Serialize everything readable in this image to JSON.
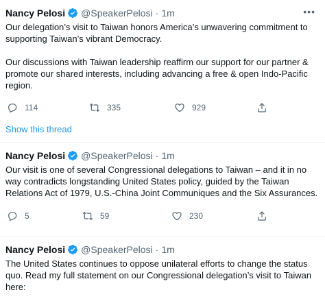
{
  "colors": {
    "accent": "#1d9bf0",
    "text": "#0f1419",
    "secondary": "#536471"
  },
  "tweets": [
    {
      "name": "Nancy Pelosi",
      "handle": "@SpeakerPelosi",
      "separator": "·",
      "time": "1m",
      "paragraphs": [
        "Our delegation’s visit to Taiwan honors America’s unwavering commitment to supporting Taiwan’s vibrant Democracy.",
        "Our discussions with Taiwan leadership reaffirm our support for our partner & promote our shared interests, including advancing a free & open Indo-Pacific region."
      ],
      "replies": "114",
      "retweets": "335",
      "likes": "929"
    },
    {
      "name": "Nancy Pelosi",
      "handle": "@SpeakerPelosi",
      "separator": "·",
      "time": "1m",
      "paragraphs": [
        "Our visit is one of several Congressional delegations to Taiwan – and it in no way contradicts longstanding United States policy, guided by the Taiwan Relations Act of 1979, U.S.-China Joint Communiques and the Six Assurances."
      ],
      "replies": "5",
      "retweets": "59",
      "likes": "230"
    },
    {
      "name": "Nancy Pelosi",
      "handle": "@SpeakerPelosi",
      "separator": "·",
      "time": "1m",
      "paragraphs": [
        "The United States continues to oppose unilateral efforts to change the status quo. Read my full statement on our Congressional delegation’s visit to Taiwan here:"
      ]
    }
  ],
  "show_thread": "Show this thread",
  "icons": [
    "verified-badge-icon",
    "more-icon",
    "reply-icon",
    "retweet-icon",
    "like-icon",
    "share-icon"
  ]
}
